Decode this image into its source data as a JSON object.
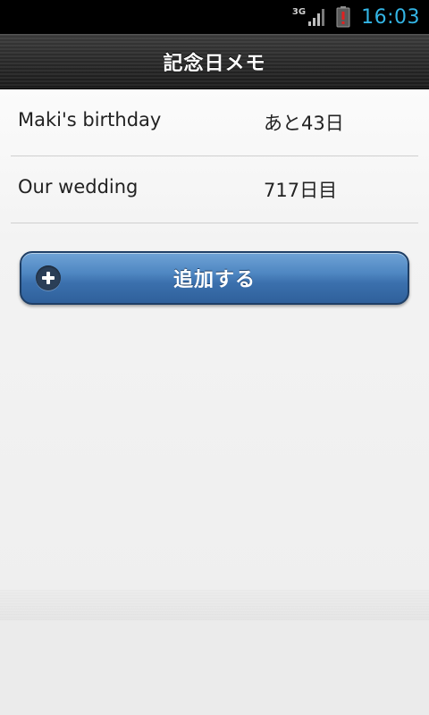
{
  "status_bar": {
    "network_type": "3G",
    "time": "16:03",
    "icons": {
      "signal": "signal-icon",
      "battery": "battery-alert-icon"
    },
    "accent_color": "#33b5e5"
  },
  "header": {
    "title": "記念日メモ"
  },
  "anniversaries": [
    {
      "name": "Maki's birthday",
      "days": "あと43日"
    },
    {
      "name": "Our wedding",
      "days": "717日目"
    }
  ],
  "add_button": {
    "label": "追加する",
    "icon": "plus-circle-icon",
    "color": "#4f87c2"
  }
}
